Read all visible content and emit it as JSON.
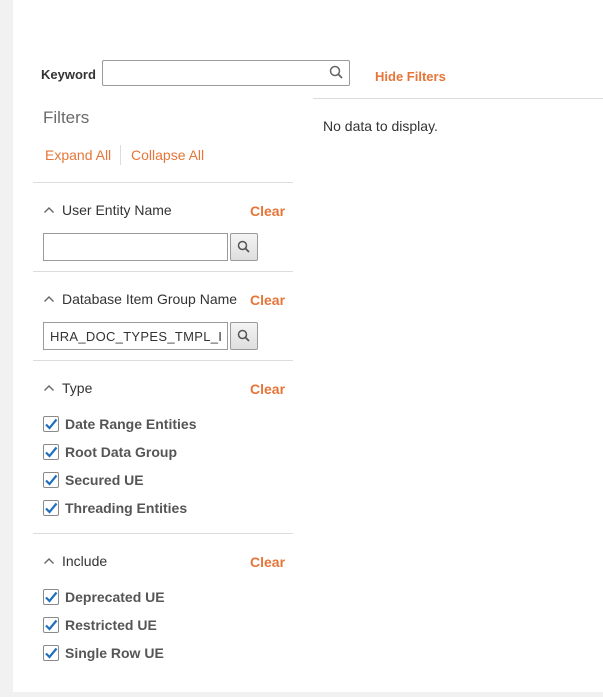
{
  "keyword": {
    "label": "Keyword",
    "value": "",
    "placeholder": ""
  },
  "hide_filters_label": "Hide Filters",
  "results": {
    "empty_text": "No data to display."
  },
  "filters": {
    "title": "Filters",
    "expand_all": "Expand All",
    "collapse_all": "Collapse All",
    "sections": [
      {
        "title": "User Entity Name",
        "clear": "Clear",
        "value": ""
      },
      {
        "title": "Database Item Group Name",
        "clear": "Clear",
        "value": "HRA_DOC_TYPES_TMPL_I"
      },
      {
        "title": "Type",
        "clear": "Clear",
        "options": [
          {
            "label": "Date Range Entities",
            "checked": true
          },
          {
            "label": "Root Data Group",
            "checked": true
          },
          {
            "label": "Secured UE",
            "checked": true
          },
          {
            "label": "Threading Entities",
            "checked": true
          }
        ]
      },
      {
        "title": "Include",
        "clear": "Clear",
        "options": [
          {
            "label": "Deprecated UE",
            "checked": true
          },
          {
            "label": "Restricted UE",
            "checked": true
          },
          {
            "label": "Single Row UE",
            "checked": true
          }
        ]
      }
    ]
  },
  "colors": {
    "accent": "#e57538",
    "checkmark": "#1f6fbf",
    "border": "#dcdcdc"
  },
  "icons": {
    "search": "search-icon",
    "collapse": "chevron-up-icon",
    "check": "checkmark-icon"
  }
}
